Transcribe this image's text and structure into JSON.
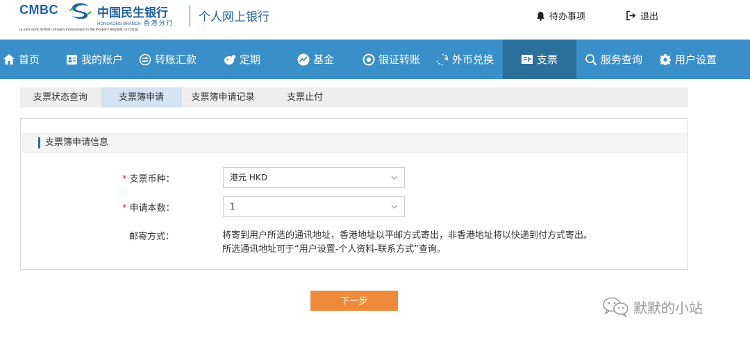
{
  "header": {
    "logo_en": "CMBC",
    "logo_cn": "中国民生银行",
    "logo_branch_en": "HONGKONG BRANCH",
    "logo_branch_cn": "香港分行",
    "logo_note": "(a joint stock limited company incorporated in the People's Republic of China)",
    "site_title": "个人网上银行",
    "todo_label": "待办事项",
    "logout_label": "退出",
    "brand_color": "#1f5fa8"
  },
  "nav": {
    "items": [
      {
        "label": "首页",
        "icon": "home-icon"
      },
      {
        "label": "我的账户",
        "icon": "account-card-icon"
      },
      {
        "label": "转账汇款",
        "icon": "transfer-icon"
      },
      {
        "label": "定期",
        "icon": "deposit-icon"
      },
      {
        "label": "基金",
        "icon": "fund-chart-icon"
      },
      {
        "label": "银证转账",
        "icon": "bank-securities-icon"
      },
      {
        "label": "外币兑换",
        "icon": "currency-exchange-icon"
      },
      {
        "label": "支票",
        "icon": "cheque-icon"
      },
      {
        "label": "服务查询",
        "icon": "search-icon"
      },
      {
        "label": "用户设置",
        "icon": "gear-icon"
      }
    ],
    "active": "支票",
    "bg_color": "#3a8fc8",
    "active_color": "#2b6f9d"
  },
  "subtabs": {
    "items": [
      "支票状态查询",
      "支票簿申请",
      "支票簿申请记录",
      "支票止付"
    ],
    "active": "支票簿申请"
  },
  "form": {
    "section_title": "支票簿申请信息",
    "currency": {
      "required_mark": "*",
      "label": "支票币种：",
      "value": "港元 HKD"
    },
    "quantity": {
      "required_mark": "*",
      "label": "申请本数：",
      "value": "1"
    },
    "mailing": {
      "label": "邮寄方式：",
      "line1": "将寄到用户所选的通讯地址，香港地址以平邮方式寄出，非香港地址将以快递到付方式寄出。",
      "line2": "所选通讯地址可于“用户设置-个人资料-联系方式”查询。"
    },
    "next_button": "下一步",
    "button_color": "#ef8a3b"
  },
  "watermark": {
    "text": "默默的小站",
    "icon": "wechat-icon"
  }
}
